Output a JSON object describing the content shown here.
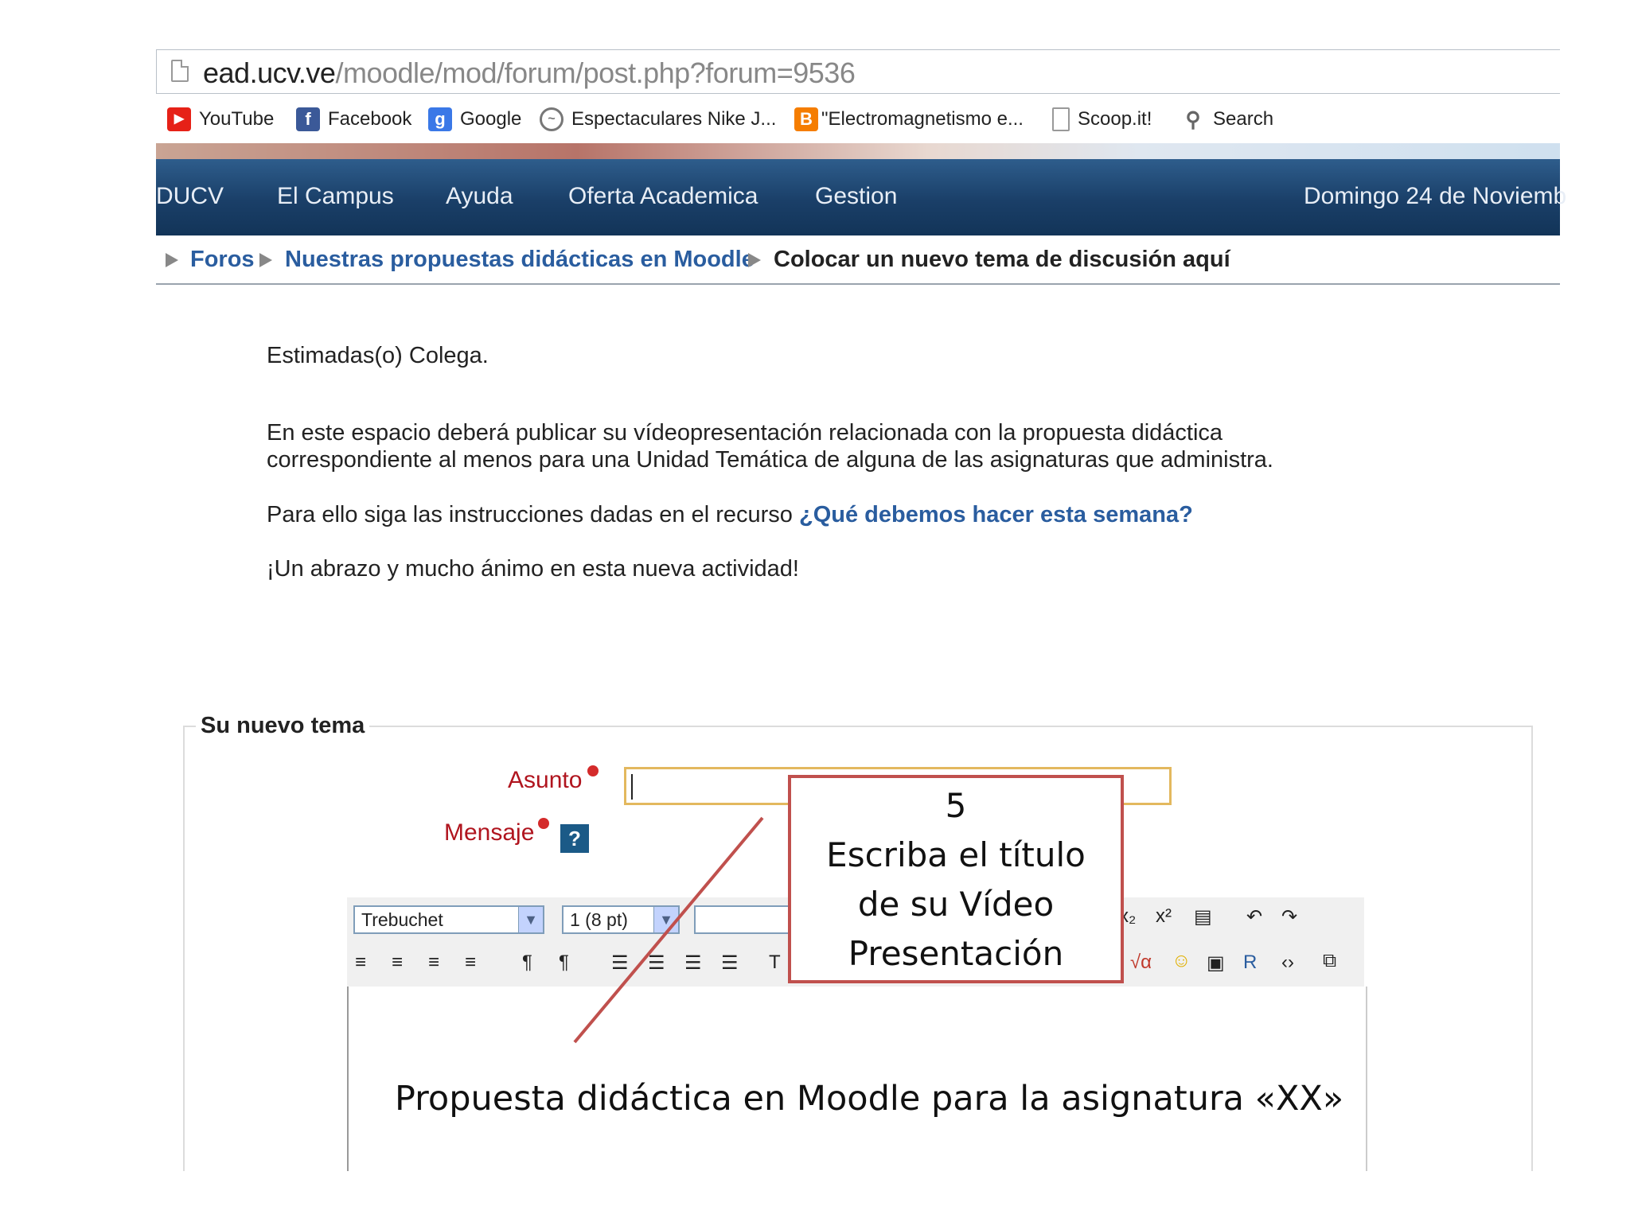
{
  "browser": {
    "url_host": "ead.ucv.ve",
    "url_path": "/moodle/mod/forum/post.php?forum=9536",
    "bookmarks": [
      {
        "label": "YouTube",
        "icon": "youtube-icon",
        "color": "#e62117"
      },
      {
        "label": "Facebook",
        "icon": "facebook-icon",
        "color": "#3b5998"
      },
      {
        "label": "Google",
        "icon": "google-icon",
        "color": "#3a78e7"
      },
      {
        "label": "Espectaculares Nike J...",
        "icon": "bookmark-site-icon",
        "color": "#777777"
      },
      {
        "label": "\"Electromagnetismo e...",
        "icon": "blogger-icon",
        "color": "#f57d00"
      },
      {
        "label": "Scoop.it!",
        "icon": "page-icon",
        "color": "#999999"
      },
      {
        "label": "Search",
        "icon": "search-icon",
        "color": "#666666"
      }
    ]
  },
  "nav": {
    "items": [
      "DUCV",
      "El Campus",
      "Ayuda",
      "Oferta Academica",
      "Gestion"
    ],
    "date": "Domingo 24 de Noviemb"
  },
  "breadcrumb": {
    "items": [
      "Foros",
      "Nuestras propuestas didácticas en Moodle",
      "Colocar un nuevo tema de discusión aquí"
    ]
  },
  "message": {
    "greeting": "Estimadas(o) Colega.",
    "line1": "En este espacio deberá publicar su vídeopresentación relacionada con la propuesta didáctica",
    "line2": "correspondiente al menos para una Unidad Temática de alguna de las asignaturas que administra.",
    "line3_prefix": "Para ello siga las instrucciones dadas en el recurso",
    "line3_link": "¿Qué debemos hacer esta semana?",
    "line4": "¡Un abrazo y mucho ánimo en esta nueva actividad!"
  },
  "form": {
    "legend": "Su nuevo tema",
    "subject_label": "Asunto",
    "message_label": "Mensaje",
    "help": "?",
    "font_select": "Trebuchet",
    "size_select": "1 (8 pt)",
    "editor_text": "Propuesta didáctica en Moodle para la asignatura «XX»"
  },
  "callout": {
    "step": "5",
    "lines": [
      "Escriba el título",
      "de su Vídeo",
      "Presentación"
    ]
  },
  "colors": {
    "nav_bg": "#1a3f68",
    "callout_border": "#c0504d",
    "required": "#b0141e",
    "link": "#2a5d9f"
  }
}
